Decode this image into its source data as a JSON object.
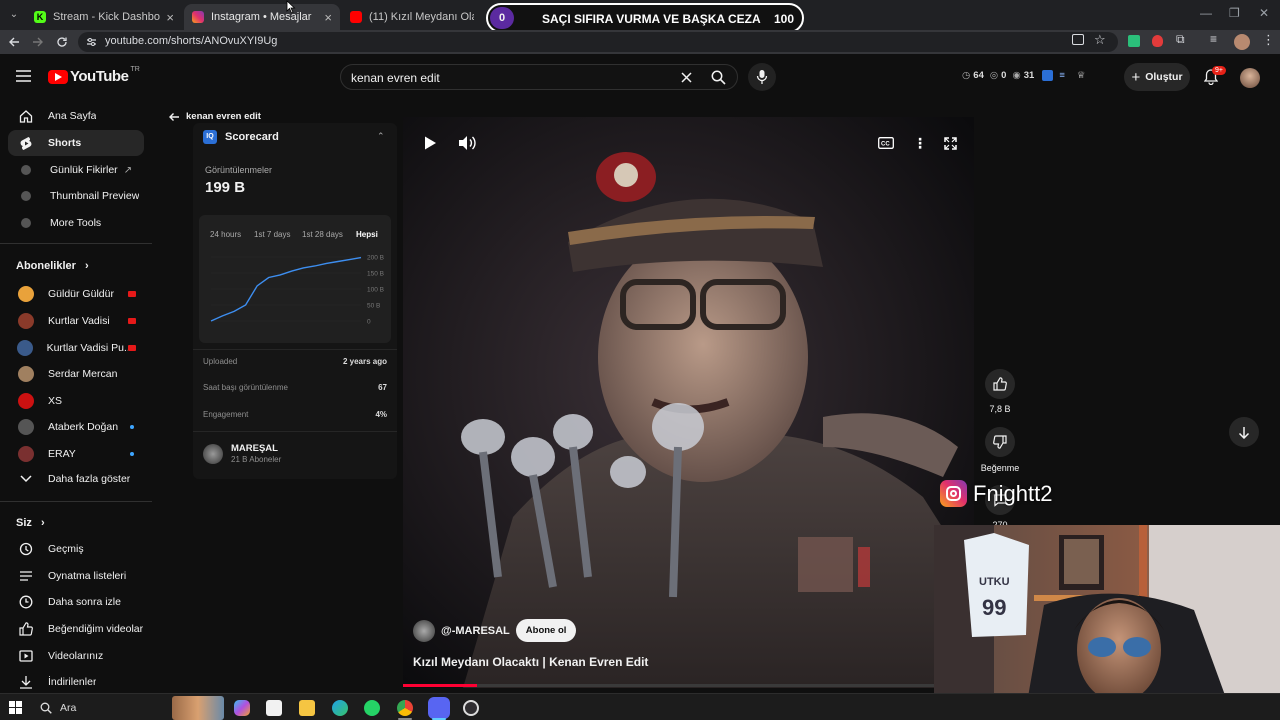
{
  "browser": {
    "tabs": [
      {
        "title": "Stream - Kick Dashboard",
        "active": false
      },
      {
        "title": "Instagram • Mesajlar",
        "active": true
      },
      {
        "title": "(11) Kızıl Meydanı Olacaktı | Ke",
        "active": false
      }
    ],
    "url": "youtube.com/shorts/ANOvuXYI9Ug"
  },
  "overlay": {
    "left_count": "0",
    "title": "SAÇI SIFIRA VURMA VE BAŞKA CEZA",
    "right_count": "100",
    "instagram_handle": "Fnightt2"
  },
  "youtube": {
    "logo_text": "YouTube",
    "region": "TR",
    "search_value": "kenan evren edit",
    "header_stats": {
      "a": "64",
      "b": "0",
      "c": "31"
    },
    "create_label": "Oluştur",
    "notif_badge": "9+"
  },
  "sidebar": {
    "main": [
      {
        "label": "Ana Sayfa",
        "icon": "home-icon"
      },
      {
        "label": "Shorts",
        "icon": "shorts-icon",
        "selected": true
      },
      {
        "label": "Günlük Fikirler",
        "icon": "ext-icon"
      },
      {
        "label": "Thumbnail Preview",
        "icon": "ext-icon"
      },
      {
        "label": "More Tools",
        "icon": "ext-icon"
      }
    ],
    "subs_title": "Abonelikler",
    "subs": [
      {
        "label": "Güldür Güldür",
        "color": "#e9a23b"
      },
      {
        "label": "Kurtlar Vadisi",
        "color": "#8a3a2a"
      },
      {
        "label": "Kurtlar Vadisi Pu...",
        "color": "#3a5a8a"
      },
      {
        "label": "Serdar Mercan",
        "color": "#a08060"
      },
      {
        "label": "XS",
        "color": "#cc1111"
      },
      {
        "label": "Ataberk Doğan",
        "color": "#555"
      },
      {
        "label": "ERAY",
        "color": "#7a3030"
      }
    ],
    "show_more": "Daha fazla göster",
    "you_title": "Siz",
    "you": [
      {
        "label": "Geçmiş",
        "icon": "history-icon"
      },
      {
        "label": "Oynatma listeleri",
        "icon": "playlist-icon"
      },
      {
        "label": "Daha sonra izle",
        "icon": "clock-icon"
      },
      {
        "label": "Beğendiğim videolar",
        "icon": "like-icon"
      },
      {
        "label": "Videolarınız",
        "icon": "video-icon"
      },
      {
        "label": "İndirilenler",
        "icon": "download-icon"
      }
    ]
  },
  "scorecard": {
    "back_label": "kenan evren edit",
    "title": "Scorecard",
    "views_label": "Görüntülenmeler",
    "views_value": "199 B",
    "ranges": [
      "24 hours",
      "1st 7 days",
      "1st 28 days",
      "Hepsi"
    ],
    "selected_range": "Hepsi",
    "stats": [
      {
        "label": "Uploaded",
        "value": "2 years ago"
      },
      {
        "label": "Saat başı görüntülenme",
        "value": "67"
      },
      {
        "label": "Engagement",
        "value": "4%"
      }
    ],
    "channel_name": "MAREŞAL",
    "channel_subs": "21 B Aboneler"
  },
  "chart_data": {
    "type": "line",
    "y_ticks": [
      "200 B",
      "150 B",
      "100 B",
      "50 B",
      "0"
    ],
    "values": [
      0,
      8,
      15,
      25,
      55,
      68,
      72,
      78,
      83,
      86,
      90,
      93,
      96,
      99
    ]
  },
  "video": {
    "channel": "@-MARESAL",
    "subscribe_label": "Abone ol",
    "title": "Kızıl Meydanı Olacaktı | Kenan Evren Edit",
    "progress": 0.13
  },
  "actions": {
    "likes": "7,8 B",
    "dislike_label": "Beğenme",
    "comments": "270"
  },
  "taskbar": {
    "search_label": "Ara"
  }
}
